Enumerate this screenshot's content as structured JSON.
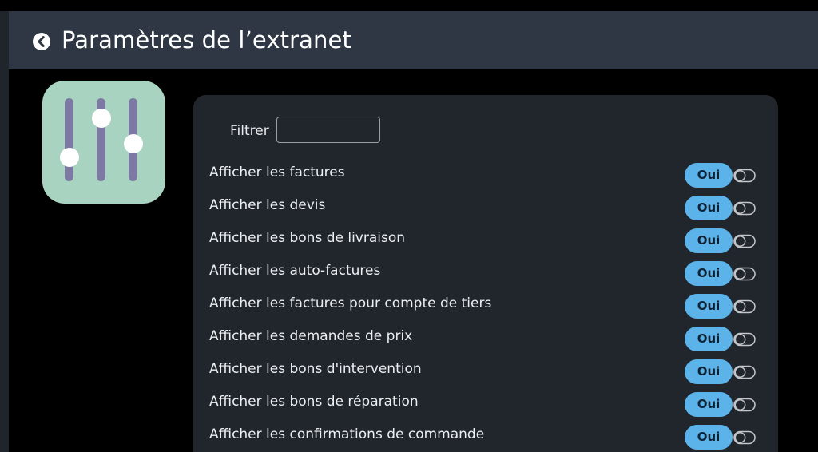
{
  "header": {
    "title": "Paramètres de l’extranet",
    "back_icon": "chevron-left-circle-icon"
  },
  "app_icon": {
    "icon": "sliders-icon",
    "background_color": "#a8d3c0",
    "track_color": "#7c7aa3",
    "knob_color": "#ffffff"
  },
  "filter": {
    "label": "Filtrer",
    "value": "",
    "placeholder": ""
  },
  "settings": [
    {
      "label": "Afficher les factures",
      "value": "Oui",
      "toggle_icon": "toggle-icon"
    },
    {
      "label": "Afficher les devis",
      "value": "Oui",
      "toggle_icon": "toggle-icon"
    },
    {
      "label": "Afficher les bons de livraison",
      "value": "Oui",
      "toggle_icon": "toggle-icon"
    },
    {
      "label": "Afficher les auto-factures",
      "value": "Oui",
      "toggle_icon": "toggle-icon"
    },
    {
      "label": "Afficher les factures pour compte de tiers",
      "value": "Oui",
      "toggle_icon": "toggle-icon"
    },
    {
      "label": "Afficher les demandes de prix",
      "value": "Oui",
      "toggle_icon": "toggle-icon"
    },
    {
      "label": "Afficher les bons d'intervention",
      "value": "Oui",
      "toggle_icon": "toggle-icon"
    },
    {
      "label": "Afficher les bons de réparation",
      "value": "Oui",
      "toggle_icon": "toggle-icon"
    },
    {
      "label": "Afficher les confirmations de commande",
      "value": "Oui",
      "toggle_icon": "toggle-icon"
    }
  ],
  "colors": {
    "page_background": "#000000",
    "header_background": "#2e3743",
    "panel_background": "#21262d",
    "badge_color": "#5cb3ea",
    "text_color": "#eceff1"
  }
}
